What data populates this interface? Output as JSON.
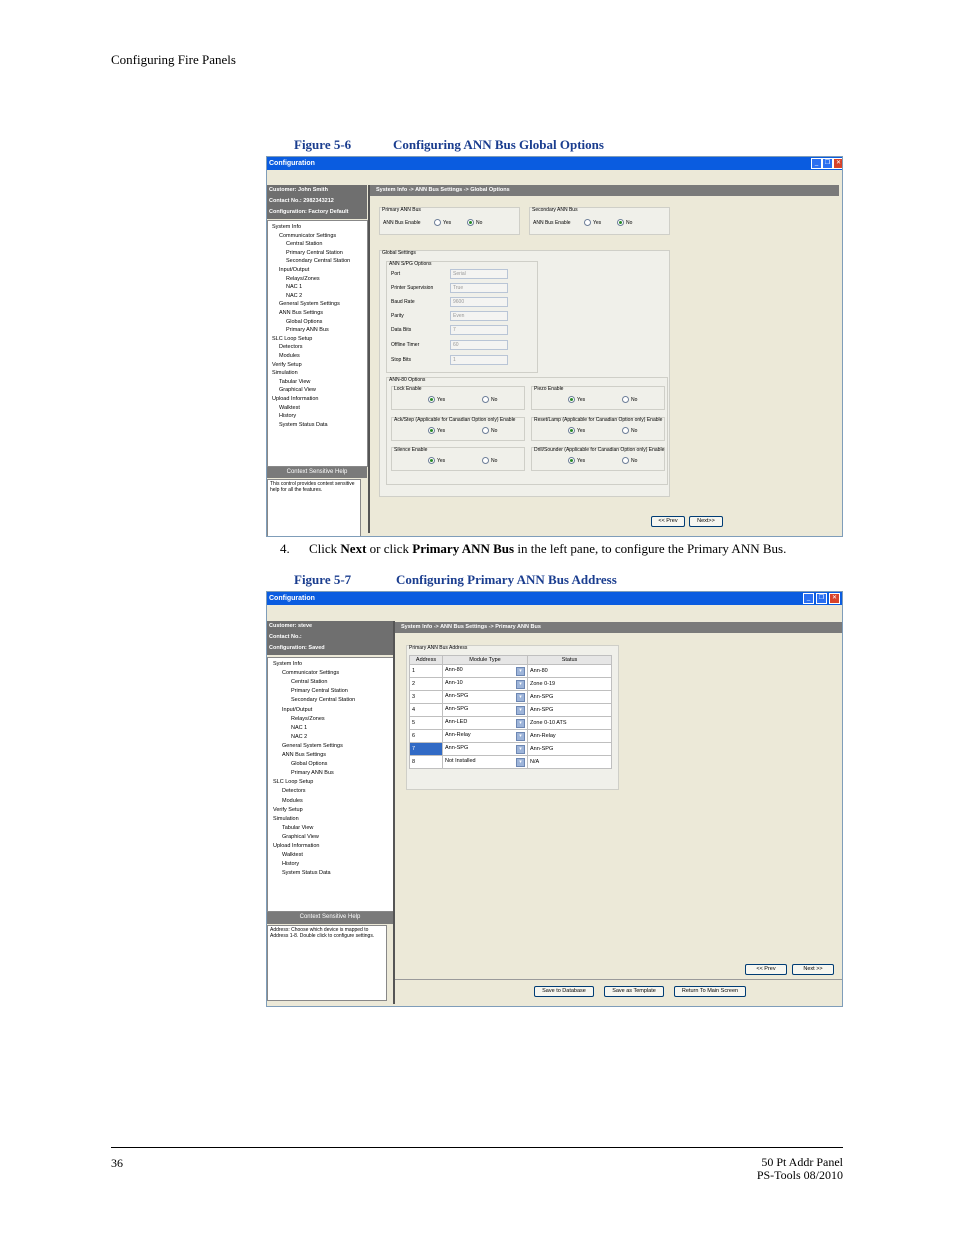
{
  "page": {
    "header": "Configuring Fire Panels",
    "figure1_label": "Figure 5-6",
    "figure1_title": "Configuring ANN Bus Global Options",
    "step_number": "4.",
    "step_pre": "Click ",
    "step_b1": "Next",
    "step_mid": " or click ",
    "step_b2": "Primary ANN Bus",
    "step_post": " in the left pane, to configure the Primary ANN Bus.",
    "figure2_label": "Figure 5-7",
    "figure2_title": "Configuring Primary ANN Bus Address",
    "page_number": "36",
    "footer_line1": "50 Pt Addr Panel",
    "footer_line2": "PS-Tools 08/2010"
  },
  "win1": {
    "title": "Configuration",
    "customer": "Customer: John Smith",
    "contact": "Contact No.: 2982343212",
    "configuration": "Configuration: Factory Default",
    "breadcrumb": "System Info -> ANN Bus Settings -> Global Options",
    "tree": [
      "System Info",
      "Communicator Settings",
      "Central Station",
      "Primary Central Station",
      "Secondary Central Station",
      "Input/Output",
      "Relays/Zones",
      "NAC 1",
      "NAC 2",
      "General System Settings",
      "ANN Bus Settings",
      "Global Options",
      "Primary ANN Bus",
      "SLC Loop Setup",
      "Detectors",
      "Modules",
      "Verify Setup",
      "Simulation",
      "Tabular View",
      "Graphical View",
      "Upload Information",
      "Walktest",
      "History",
      "System Status Data"
    ],
    "ctx_title": "Context Sensitive Help",
    "ctx_text": "This control provides context sensitive help for all the features.",
    "primary_group": "Primary ANN Bus",
    "secondary_group": "Secondary ANN Bus",
    "ann_bus_enable": "ANN Bus Enable",
    "yes": "Yes",
    "no": "No",
    "global_settings": "Global Settings",
    "sps_options": "ANN S/PG Options",
    "port": "Port",
    "port_val": "Serial",
    "printer_supervision": "Printer Supervision",
    "printer_val": "True",
    "baud_rate": "Baud Rate",
    "baud_val": "9600",
    "parity": "Parity",
    "parity_val": "Even",
    "data_bits": "Data Bits",
    "data_val": "7",
    "offline_timer": "Offline Timer",
    "offline_val": "60",
    "stop_bits": "Stop Bits",
    "stop_val": "1",
    "ui_options": "ANN-80 Options",
    "lock_enable": "Lock Enable",
    "piezo_enable": "Piezo Enable",
    "ackstep": "Ack/Step (Applicable for Canadian Option only) Enable",
    "reset_lamp": "Reset/Lamp (Applicable for Canadian Option only) Enable",
    "silence_enable": "Silence Enable",
    "drill": "Drill/Sounder (Applicable for Canadian Option only) Enable",
    "prev": "<< Prev",
    "next": "Next>>"
  },
  "win2": {
    "title": "Configuration",
    "customer": "Customer: steve",
    "contact": "Contact No.:",
    "configuration": "Configuration: Saved",
    "breadcrumb": "System Info -> ANN Bus Settings -> Primary ANN Bus",
    "tree": [
      "System Info",
      "Communicator Settings",
      "Central Station",
      "Primary Central Station",
      "Secondary Central Station",
      "Input/Output",
      "Relays/Zones",
      "NAC 1",
      "NAC 2",
      "General System Settings",
      "ANN Bus Settings",
      "Global Options",
      "Primary ANN Bus",
      "SLC Loop Setup",
      "Detectors",
      "Modules",
      "Verify Setup",
      "Simulation",
      "Tabular View",
      "Graphical View",
      "Upload Information",
      "Walktest",
      "History",
      "System Status Data"
    ],
    "ctx_title": "Context Sensitive Help",
    "ctx_text": "Address: Choose which device is mapped to Address 1-8. Double click to configure settings.",
    "group": "Primary ANN Bus Address",
    "col_address": "Address",
    "col_module": "Module Type",
    "col_status": "Status",
    "rows": [
      {
        "address": "1",
        "module": "Ann-80",
        "status": "Ann-80"
      },
      {
        "address": "2",
        "module": "Ann-10",
        "status": "Zone 0-19"
      },
      {
        "address": "3",
        "module": "Ann-SPG",
        "status": "Ann-SPG"
      },
      {
        "address": "4",
        "module": "Ann-SPG",
        "status": "Ann-SPG"
      },
      {
        "address": "5",
        "module": "Ann-LED",
        "status": "Zone 0-10 ATS"
      },
      {
        "address": "6",
        "module": "Ann-Relay",
        "status": "Ann-Relay"
      },
      {
        "address": "7",
        "module": "Ann-SPG",
        "status": "Ann-SPG"
      },
      {
        "address": "8",
        "module": "Not Installed",
        "status": "N/A"
      }
    ],
    "prev": "<< Prev",
    "next": "Next >>",
    "save_db": "Save to Database",
    "save_tpl": "Save as Template",
    "return_main": "Return To Main Screen"
  }
}
